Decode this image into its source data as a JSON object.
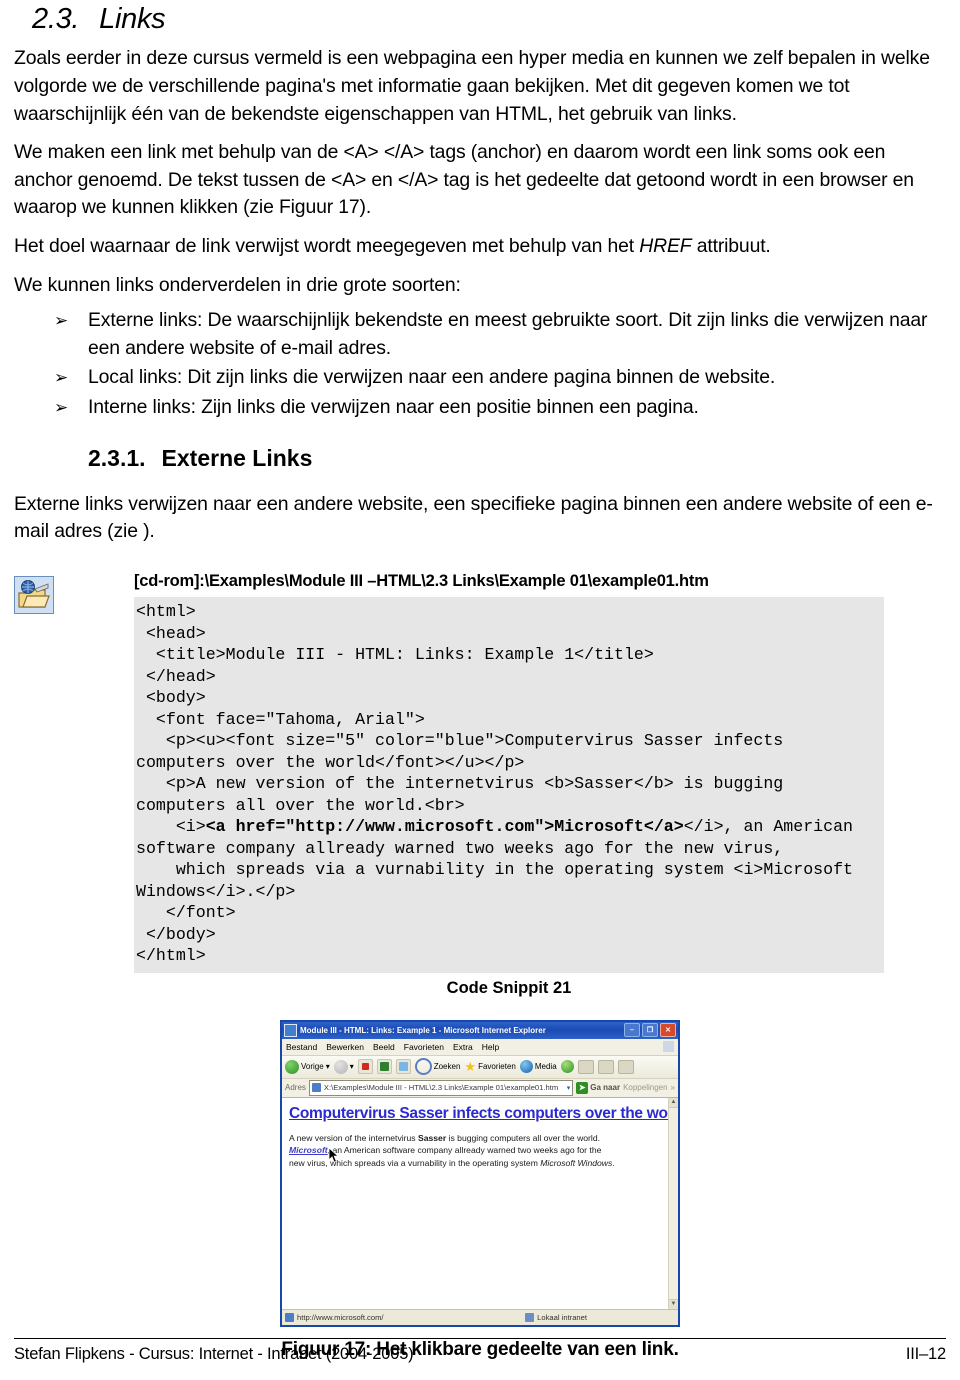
{
  "heading": {
    "number": "2.3.",
    "title": "Links"
  },
  "paragraphs": {
    "p1": "Zoals eerder in deze cursus vermeld is een webpagina een hyper media en kunnen we zelf bepalen in welke volgorde we de verschillende pagina's met informatie gaan bekijken.  Met dit gegeven komen we tot waarschijnlijk één van de bekendste eigenschappen van HTML, het gebruik van links.",
    "p2": "We maken een link met behulp van de <A> </A> tags (anchor) en daarom wordt een link soms ook een anchor genoemd.  De tekst tussen de <A> en </A> tag is het gedeelte dat getoond wordt in een browser en waarop we kunnen klikken (zie Figuur 17).",
    "p3_before": "Het doel waarnaar de link verwijst wordt meegegeven met behulp van het ",
    "p3_italic": "HREF",
    "p3_after": " attribuut.",
    "p4": "We kunnen links onderverdelen in drie grote soorten:",
    "p5": "Externe links verwijzen naar een andere website, een specifieke pagina binnen een andere website of een e-mail adres (zie )."
  },
  "bullets": {
    "marker": "➢",
    "items": [
      "Externe links:  De waarschijnlijk bekendste en meest gebruikte soort.  Dit zijn links die verwijzen naar een andere website of e-mail adres.",
      "Local links:  Dit zijn links die verwijzen naar een andere pagina binnen de website.",
      "Interne links:  Zijn links die verwijzen naar een positie binnen een pagina."
    ]
  },
  "subheading": {
    "number": "2.3.1.",
    "title": "Externe Links"
  },
  "example": {
    "icon_name": "cdrom-folder-icon",
    "path": "[cd-rom]:\\Examples\\Module III –HTML\\2.3 Links\\Example 01\\example01.htm",
    "code_lines": [
      {
        "text": "<html>",
        "bold": false
      },
      {
        "text": " <head>",
        "bold": false
      },
      {
        "text": "  <title>Module III - HTML: Links: Example 1</title>",
        "bold": false
      },
      {
        "text": " </head>",
        "bold": false
      },
      {
        "text": " <body>",
        "bold": false
      },
      {
        "text": "  <font face=\"Tahoma, Arial\">",
        "bold": false
      },
      {
        "text": "   <p><u><font size=\"5\" color=\"blue\">Computervirus Sasser infects computers over the world</font></u></p>",
        "bold": false
      },
      {
        "text": "   <p>A new version of the internetvirus <b>Sasser</b> is bugging computers all over the world.<br>",
        "bold": false
      },
      {
        "text": "    <i>",
        "bold": false,
        "inline_bold": "<a href=\"http://www.microsoft.com\">Microsoft</a>",
        "tail": "</i>, an American software company allready warned two weeks ago for the new virus,"
      },
      {
        "text": "    which spreads via a vurnability in the operating system <i>Microsoft Windows</i>.</p>",
        "bold": false
      },
      {
        "text": "   </font>",
        "bold": false
      },
      {
        "text": " </body>",
        "bold": false
      },
      {
        "text": "</html>",
        "bold": false
      }
    ],
    "caption": "Code Snippit 21"
  },
  "browser": {
    "title": "Module III - HTML: Links: Example 1 - Microsoft Internet Explorer",
    "window_buttons": {
      "minimize": "–",
      "maximize": "❐",
      "close": "✕"
    },
    "menu": [
      "Bestand",
      "Bewerken",
      "Beeld",
      "Favorieten",
      "Extra",
      "Help"
    ],
    "toolbar": {
      "back": "Vorige",
      "back_caret": "▾",
      "forward_caret": "▾",
      "search": "Zoeken",
      "favorites": "Favorieten",
      "media": "Media"
    },
    "address": {
      "label": "Adres",
      "value": "X:\\Examples\\Module III - HTML\\2.3 Links\\Example 01\\example01.htm",
      "dropdown_caret": "▾",
      "go_label": "Ga naar",
      "go_arrow": "➤",
      "links_label": "Koppelingen",
      "chevron": "»"
    },
    "page": {
      "heading": "Computervirus Sasser infects computers over the world",
      "body_1": "A new version of the internetvirus ",
      "body_bold": "Sasser",
      "body_2": " is bugging computers all over the world.",
      "link_text": "Microsoft",
      "body_3": ", an American software company allready warned two weeks ago for the new virus, which spreads via a vurnability in the operating system ",
      "body_italic": "Microsoft Windows",
      "body_4": "."
    },
    "status": {
      "url": "http://www.microsoft.com/",
      "zone": "Lokaal intranet"
    },
    "scrollbar": {
      "up": "▲",
      "down": "▼"
    }
  },
  "figure_caption": "Figuur 17:  Het klikbare gedeelte van een link.",
  "footer": {
    "left": "Stefan Flipkens - Cursus:  Internet - Intranet (2004-2005)",
    "right": "III–12"
  },
  "colors": {
    "code_bg": "#e6e6e6",
    "link_blue": "#2a2ad0",
    "title_bar_blue": "#1b4ab4"
  }
}
